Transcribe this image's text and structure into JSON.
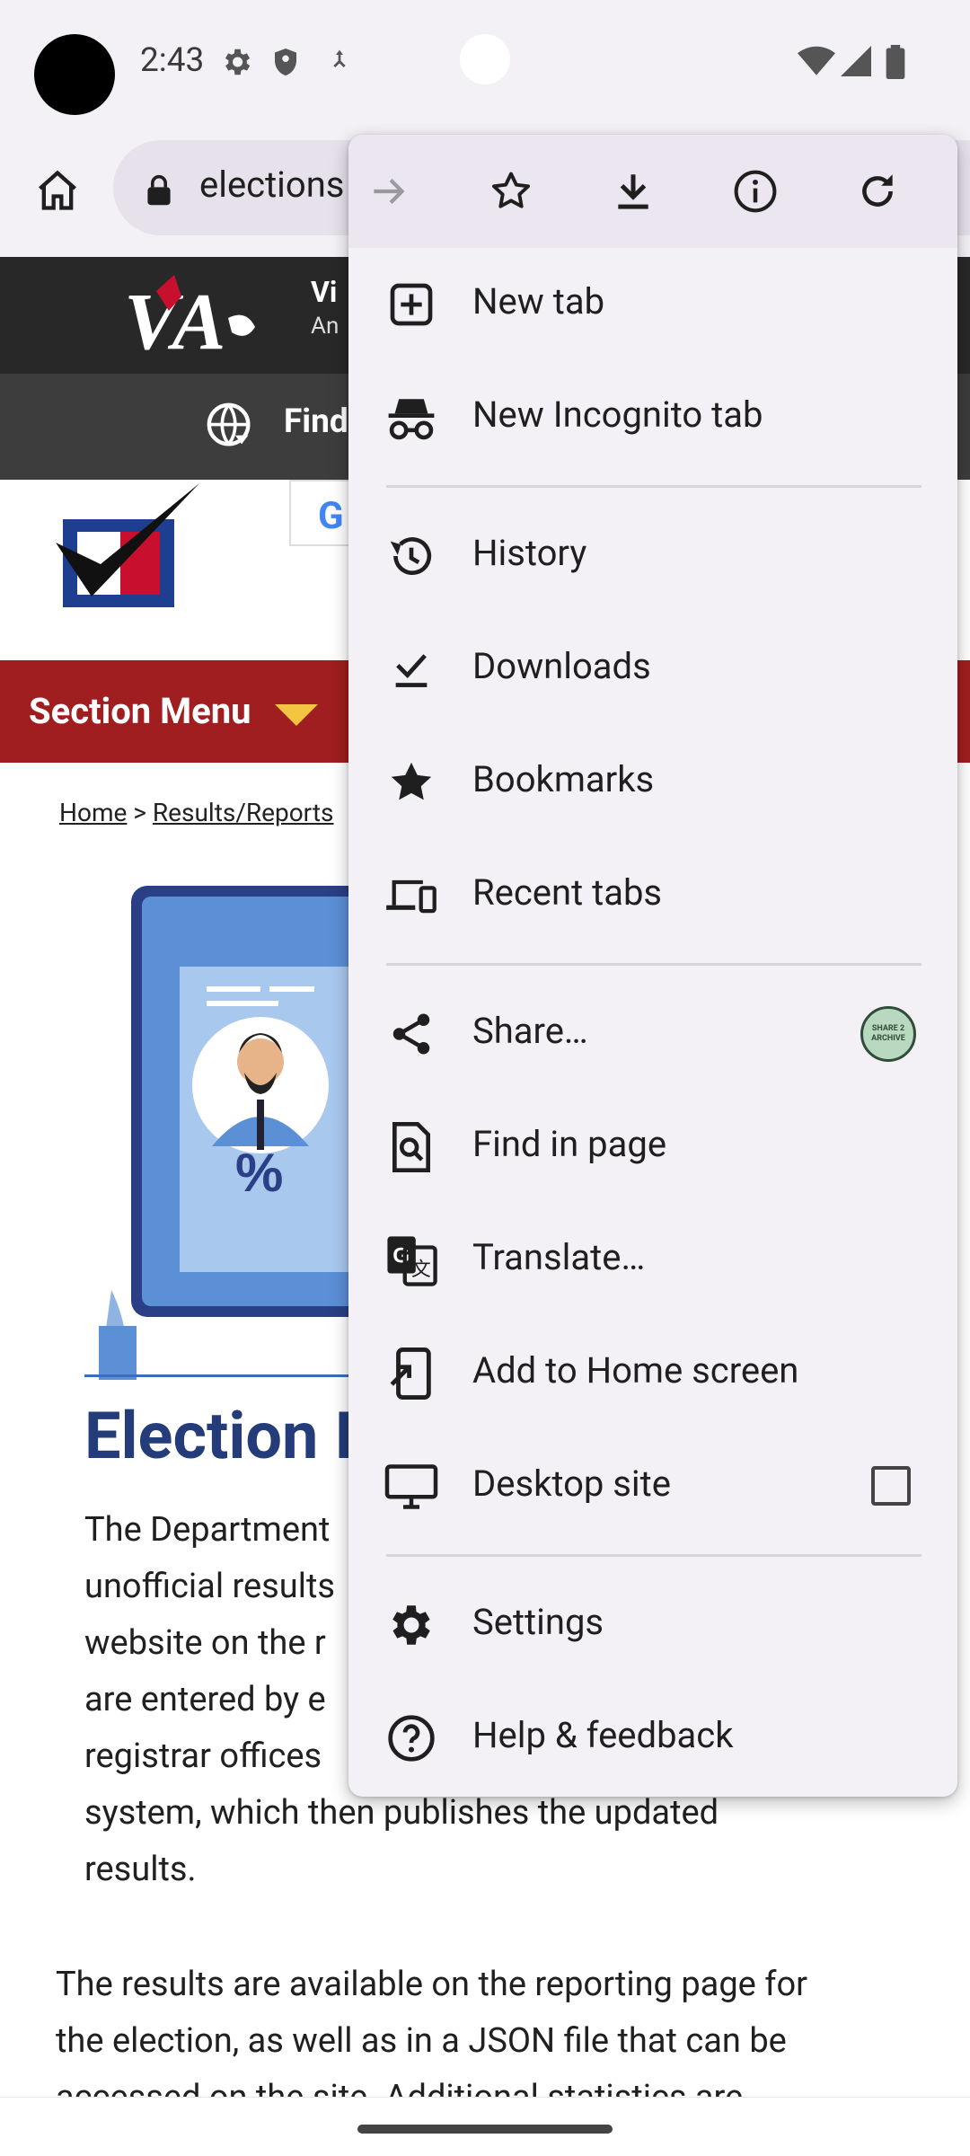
{
  "status_bar": {
    "time": "2:43",
    "icons": [
      "settings-gear-icon",
      "shield-icon",
      "accessibility-icon",
      "wifi-icon",
      "signal-icon",
      "battery-icon"
    ]
  },
  "toolbar": {
    "url": "elections",
    "home_icon": "home-icon",
    "lock_icon": "lock-icon"
  },
  "page": {
    "header_short": "Vi",
    "header_sub": "An",
    "find_text": "Find",
    "section_menu": "Section Menu",
    "breadcrumb": {
      "home": "Home",
      "sep": ">",
      "results": "Results/Reports"
    },
    "percent_symbol": "%",
    "title": "Election I",
    "paragraph1": "The Department unofficial results website on the r are entered by e registrar offices system, which then publishes the updated results.",
    "paragraph1_lines": [
      "The Department",
      "unofficial results",
      "website on the r",
      "are entered by e",
      "registrar offices",
      "system, which then publishes the updated",
      "results."
    ],
    "paragraph2_lines": [
      "The results are available on the reporting page for",
      "the election, as well as in a JSON file that can be",
      "accessed on the site. Additional statistics are"
    ]
  },
  "menu": {
    "top_actions": [
      {
        "name": "forward-icon",
        "enabled": false
      },
      {
        "name": "bookmark-star-outline-icon",
        "enabled": true
      },
      {
        "name": "download-icon",
        "enabled": true
      },
      {
        "name": "info-icon",
        "enabled": true
      },
      {
        "name": "refresh-icon",
        "enabled": true
      }
    ],
    "items": [
      {
        "label": "New tab",
        "icon": "new-tab-icon"
      },
      {
        "label": "New Incognito tab",
        "icon": "incognito-icon"
      },
      {
        "label": "History",
        "icon": "history-icon"
      },
      {
        "label": "Downloads",
        "icon": "downloads-icon"
      },
      {
        "label": "Bookmarks",
        "icon": "bookmarks-icon"
      },
      {
        "label": "Recent tabs",
        "icon": "recent-tabs-icon"
      },
      {
        "label": "Share…",
        "icon": "share-icon",
        "badge": "SHARE 2 ARCHIVE"
      },
      {
        "label": "Find in page",
        "icon": "find-in-page-icon"
      },
      {
        "label": "Translate…",
        "icon": "translate-icon"
      },
      {
        "label": "Add to Home screen",
        "icon": "add-to-home-icon"
      },
      {
        "label": "Desktop site",
        "icon": "desktop-icon",
        "checked": false
      },
      {
        "label": "Settings",
        "icon": "settings-icon"
      },
      {
        "label": "Help & feedback",
        "icon": "help-icon"
      }
    ]
  },
  "colors": {
    "menu_bg": "#f4f1f6",
    "section_bar": "#a01e1f",
    "title_blue": "#243c7a",
    "header_dark": "#282828"
  }
}
